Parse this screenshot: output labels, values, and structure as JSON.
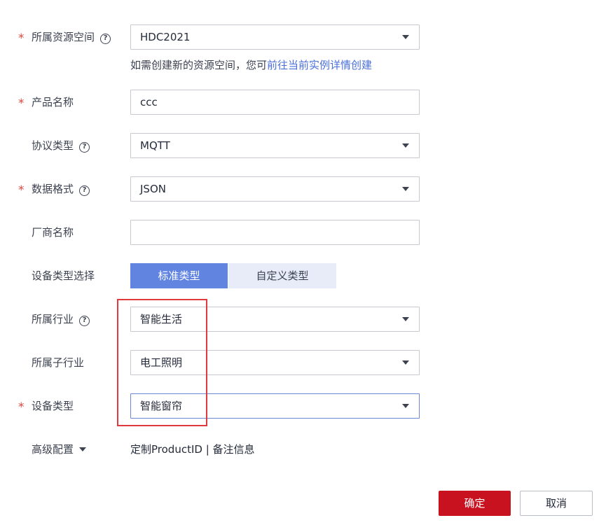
{
  "form": {
    "workspace": {
      "label": "所属资源空间",
      "required": "*",
      "value": "HDC2021",
      "help": "?"
    },
    "workspace_hint": {
      "text": "如需创建新的资源空间，您可",
      "link": "前往当前实例详情创建"
    },
    "product_name": {
      "label": "产品名称",
      "required": "*",
      "value": "ccc"
    },
    "protocol": {
      "label": "协议类型",
      "value": "MQTT",
      "help": "?"
    },
    "data_format": {
      "label": "数据格式",
      "required": "*",
      "value": "JSON",
      "help": "?"
    },
    "vendor": {
      "label": "厂商名称",
      "value": ""
    },
    "device_type_select": {
      "label": "设备类型选择",
      "options": [
        "标准类型",
        "自定义类型"
      ],
      "selected": "标准类型"
    },
    "industry": {
      "label": "所属行业",
      "value": "智能生活",
      "help": "?"
    },
    "sub_industry": {
      "label": "所属子行业",
      "value": "电工照明"
    },
    "device_type": {
      "label": "设备类型",
      "required": "*",
      "value": "智能窗帘"
    },
    "advanced": {
      "label": "高级配置",
      "links": "定制ProductID | 备注信息"
    }
  },
  "footer": {
    "ok_label": "确定",
    "cancel_label": "取消"
  },
  "colors": {
    "primary_button": "#c8121f",
    "segment_active": "#6084e0",
    "link": "#4a6fd8",
    "highlight": "#e0393e"
  }
}
